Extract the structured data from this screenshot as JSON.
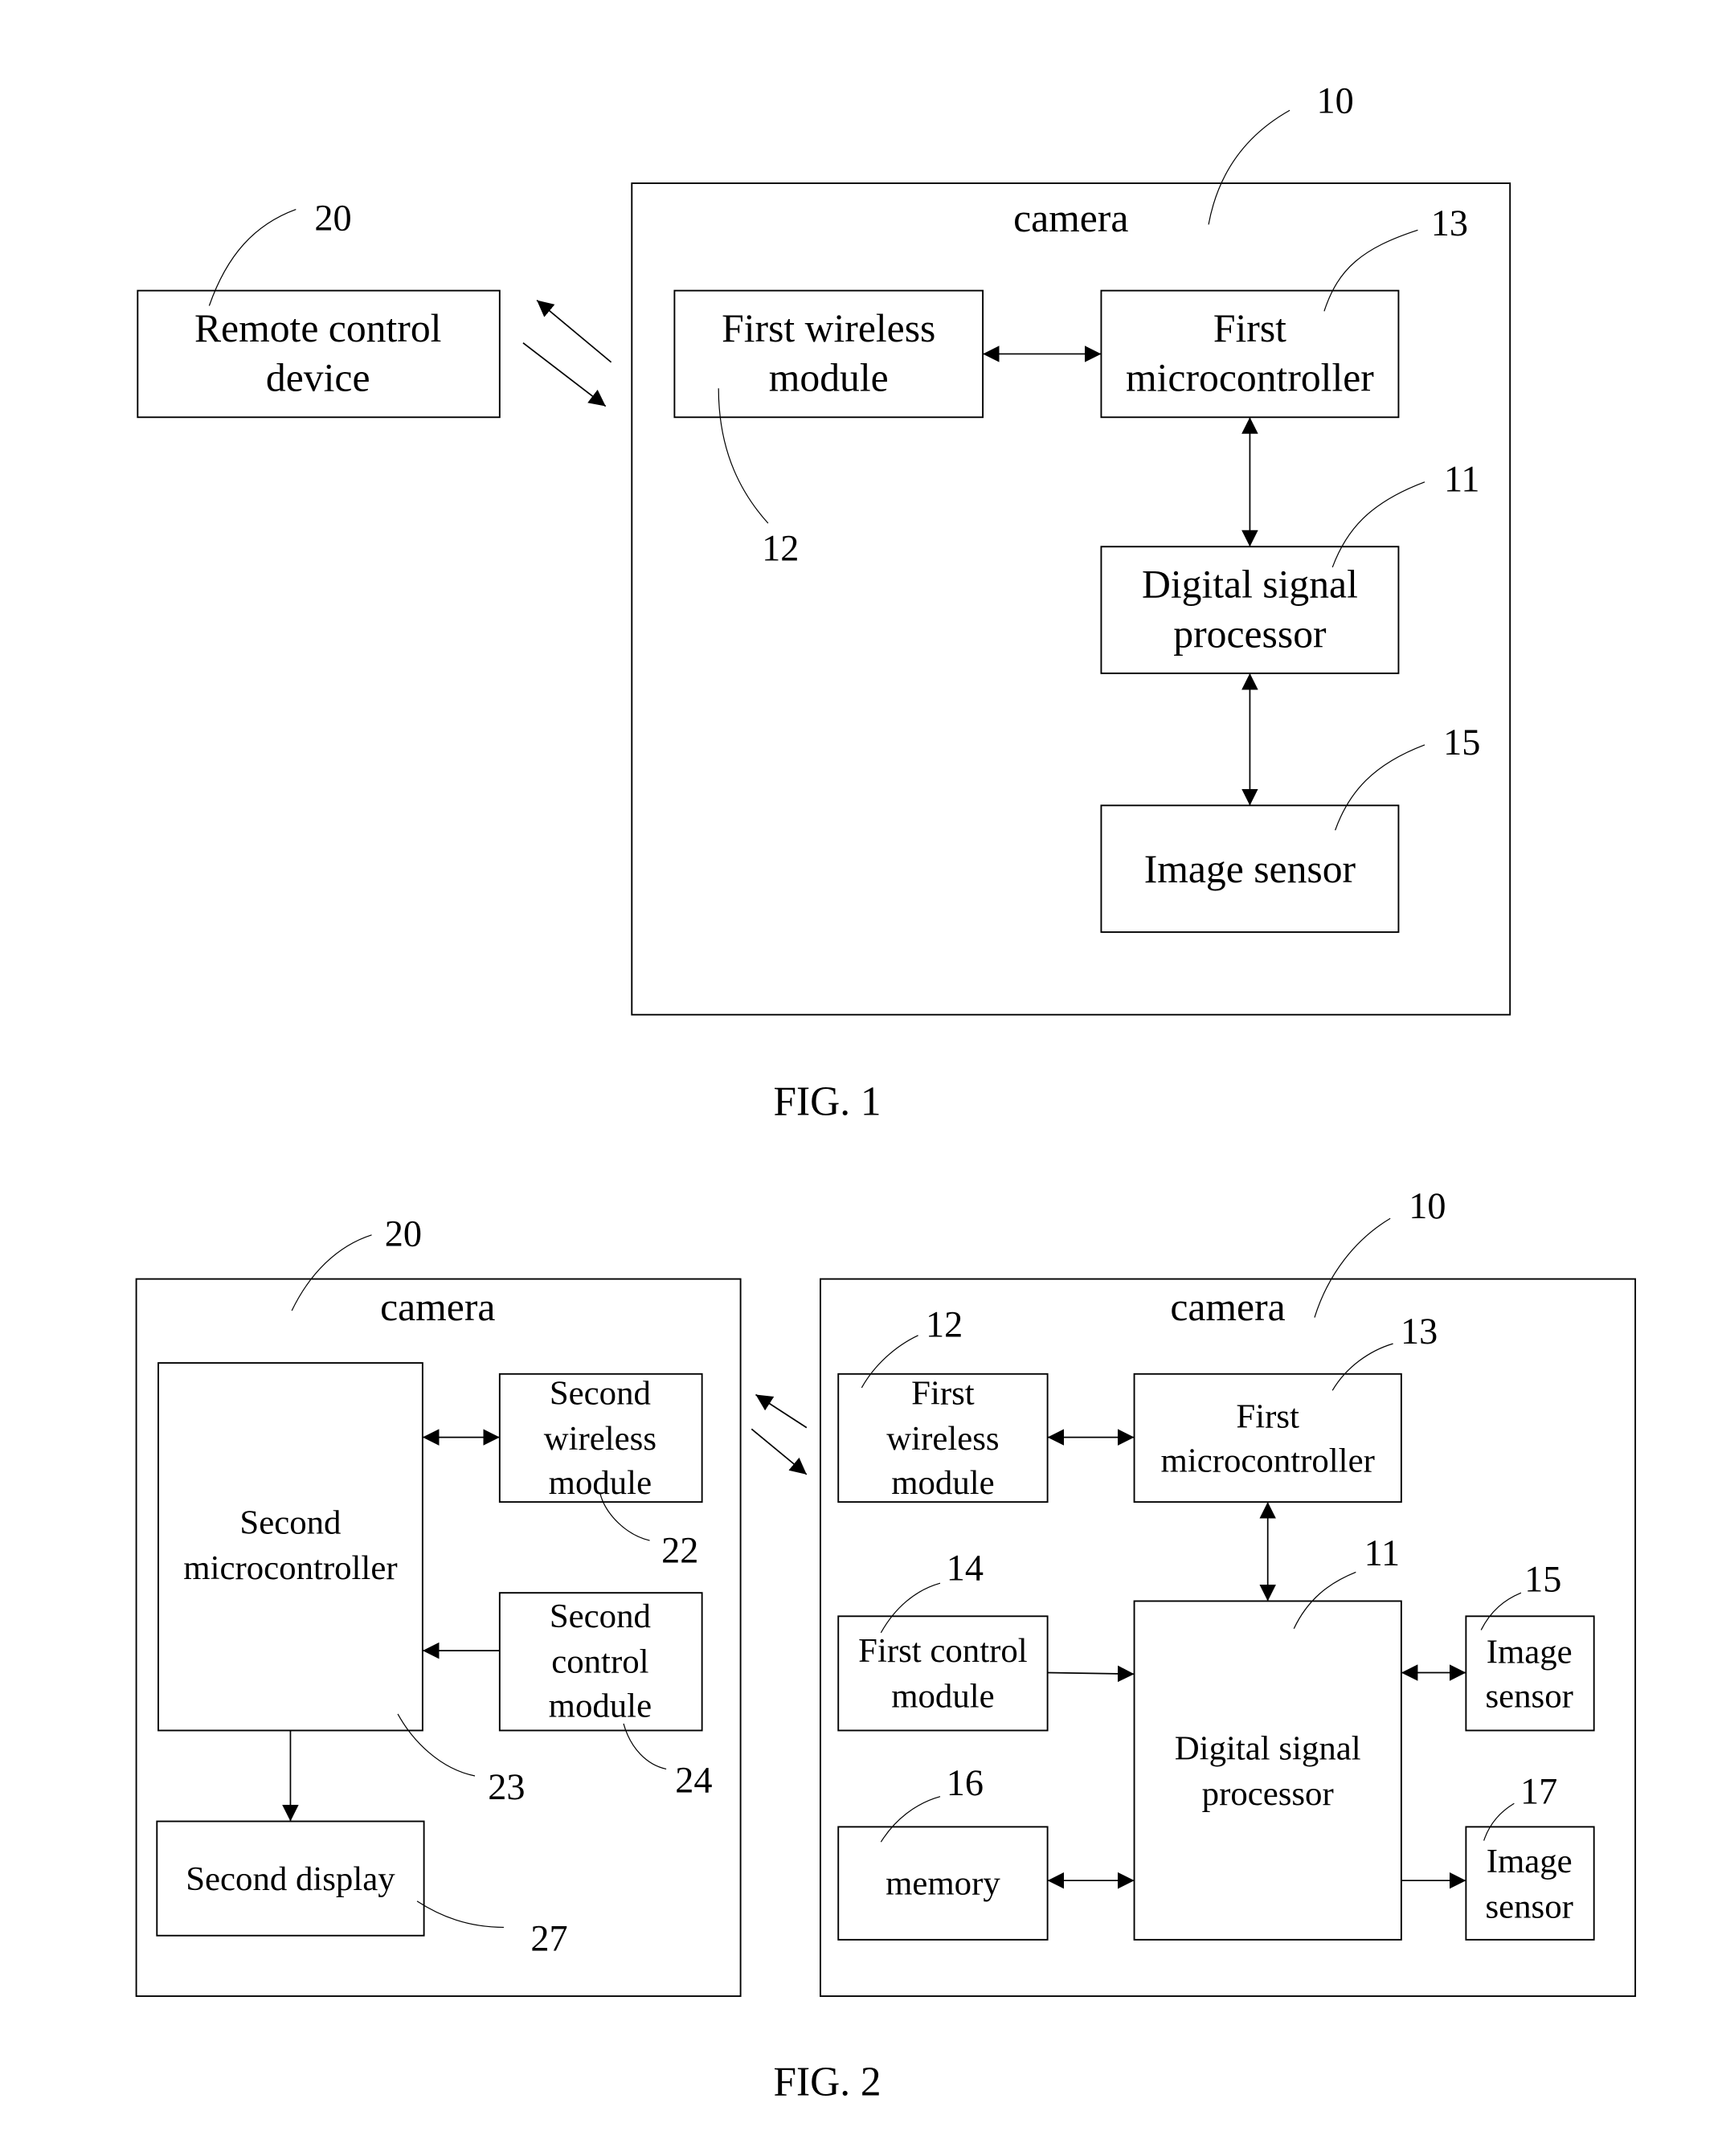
{
  "fig1": {
    "caption": "FIG. 1",
    "remote": {
      "lines": [
        "Remote control",
        "device"
      ],
      "ref": "20"
    },
    "camera": {
      "title": "camera",
      "ref": "10"
    },
    "first_wireless": {
      "lines": [
        "First wireless",
        "module"
      ],
      "ref": "12"
    },
    "first_mcu": {
      "lines": [
        "First",
        "microcontroller"
      ],
      "ref": "13"
    },
    "dsp": {
      "lines": [
        "Digital signal",
        "processor"
      ],
      "ref": "11"
    },
    "image_sensor": {
      "lines": [
        "Image sensor"
      ],
      "ref": "15"
    }
  },
  "fig2": {
    "caption": "FIG. 2",
    "camera2": {
      "title": "camera",
      "ref": "20"
    },
    "second_mcu": {
      "lines": [
        "Second",
        "microcontroller"
      ],
      "ref": "23"
    },
    "second_wireless": {
      "lines": [
        "Second",
        "wireless",
        "module"
      ],
      "ref": "22"
    },
    "second_control": {
      "lines": [
        "Second",
        "control",
        "module"
      ],
      "ref": "24"
    },
    "second_display": {
      "lines": [
        "Second display"
      ],
      "ref": "27"
    },
    "camera1": {
      "title": "camera",
      "ref": "10"
    },
    "first_wireless": {
      "lines": [
        "First",
        "wireless",
        "module"
      ],
      "ref": "12"
    },
    "first_mcu": {
      "lines": [
        "First",
        "microcontroller"
      ],
      "ref": "13"
    },
    "first_control": {
      "lines": [
        "First control",
        "module"
      ],
      "ref": "14"
    },
    "memory": {
      "lines": [
        "memory"
      ],
      "ref": "16"
    },
    "dsp": {
      "lines": [
        "Digital signal",
        "processor"
      ],
      "ref": "11"
    },
    "image_sensor_a": {
      "lines": [
        "Image",
        "sensor"
      ],
      "ref": "15"
    },
    "image_sensor_b": {
      "lines": [
        "Image",
        "sensor"
      ],
      "ref": "17"
    }
  }
}
